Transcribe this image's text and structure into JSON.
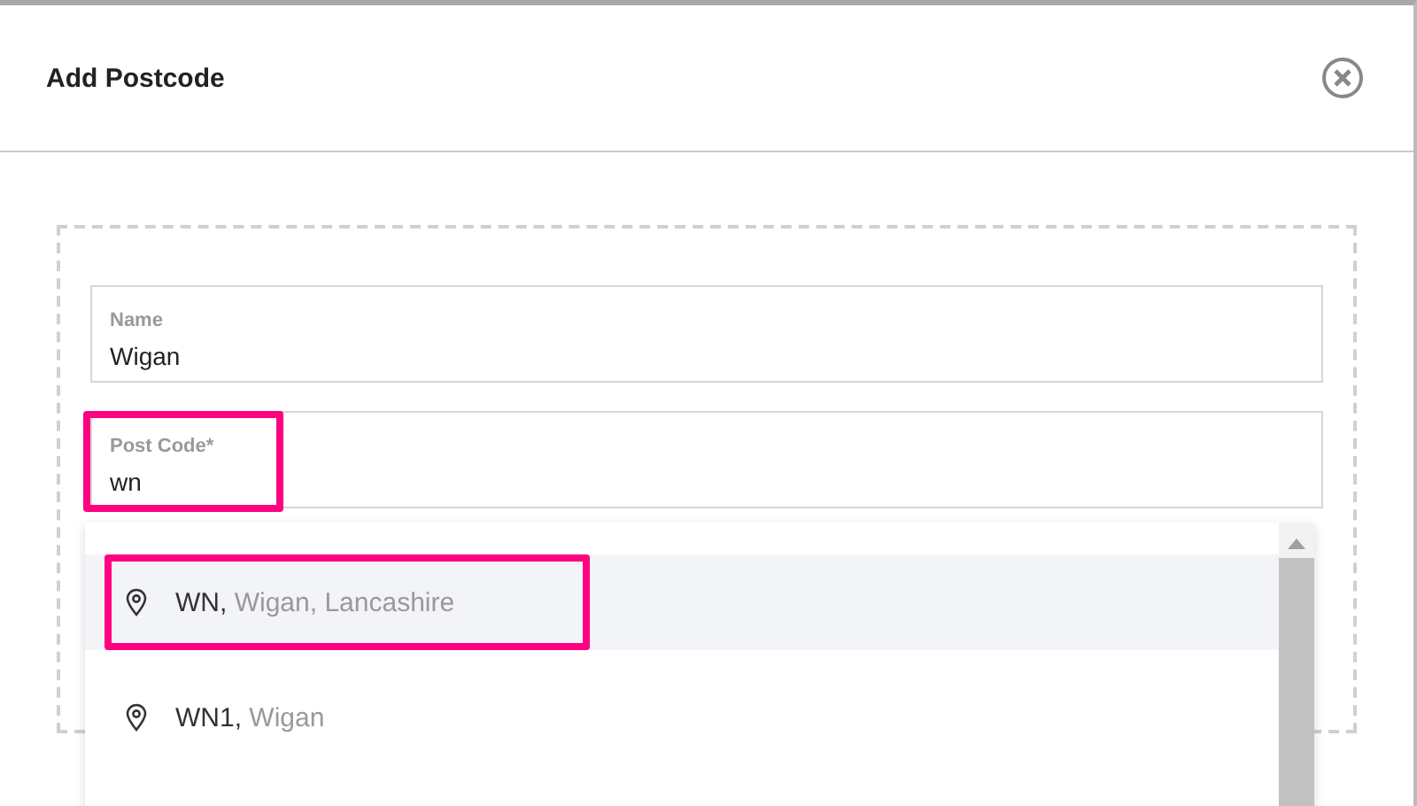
{
  "dialog": {
    "title": "Add Postcode"
  },
  "fields": [
    {
      "label": "Name",
      "value": "Wigan",
      "marked": false
    },
    {
      "label": "Post Code*",
      "value": "wn",
      "marked": true
    }
  ],
  "suggestions": [
    {
      "code": "WN,",
      "detail": "Wigan, Lancashire",
      "selected": true,
      "marked": true
    },
    {
      "code": "WN1,",
      "detail": "Wigan",
      "selected": false,
      "marked": false
    }
  ]
}
